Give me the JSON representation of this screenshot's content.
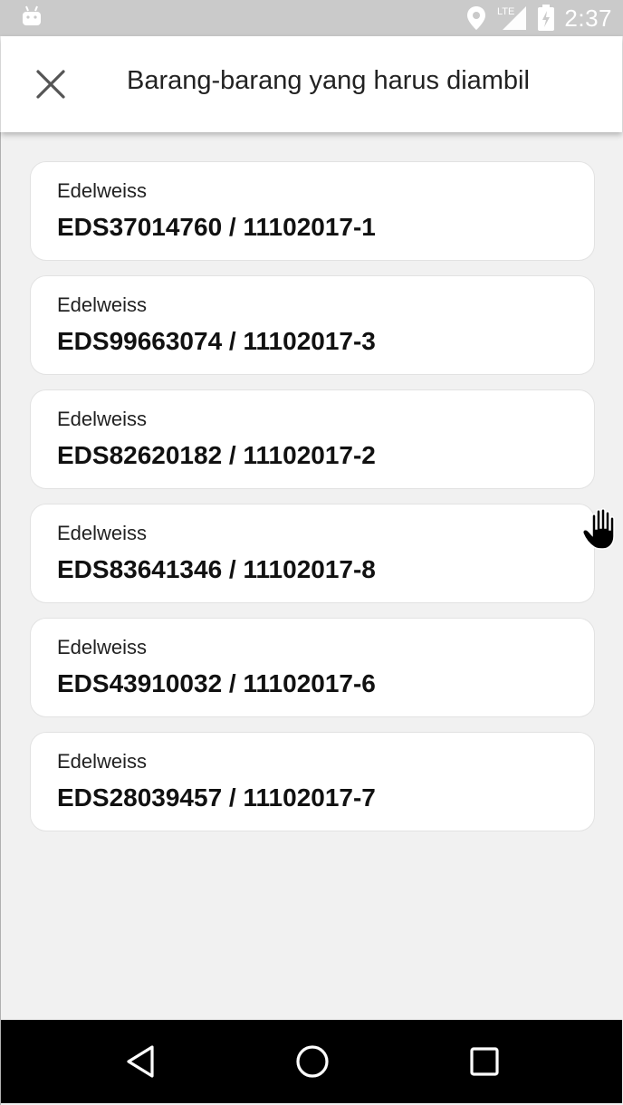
{
  "status_bar": {
    "time": "2:37",
    "network_label": "LTE",
    "icons": [
      "android-icon",
      "location-pin-icon",
      "signal-icon",
      "battery-charging-icon"
    ]
  },
  "app_bar": {
    "title": "Barang-barang yang harus diambil",
    "close_icon": "close-icon"
  },
  "items": [
    {
      "vendor": "Edelweiss",
      "code": "EDS37014760 / 11102017-1"
    },
    {
      "vendor": "Edelweiss",
      "code": "EDS99663074 / 11102017-3"
    },
    {
      "vendor": "Edelweiss",
      "code": "EDS82620182 / 11102017-2"
    },
    {
      "vendor": "Edelweiss",
      "code": "EDS83641346 / 11102017-8"
    },
    {
      "vendor": "Edelweiss",
      "code": "EDS43910032 / 11102017-6"
    },
    {
      "vendor": "Edelweiss",
      "code": "EDS28039457 / 11102017-7"
    }
  ],
  "nav_bar": {
    "icons": [
      "back-triangle-icon",
      "home-circle-icon",
      "recents-square-icon"
    ]
  },
  "colors": {
    "status_bar_bg": "#cacaca",
    "app_bar_bg": "#ffffff",
    "page_bg": "#f1f1f1",
    "nav_bar_bg": "#000000"
  }
}
